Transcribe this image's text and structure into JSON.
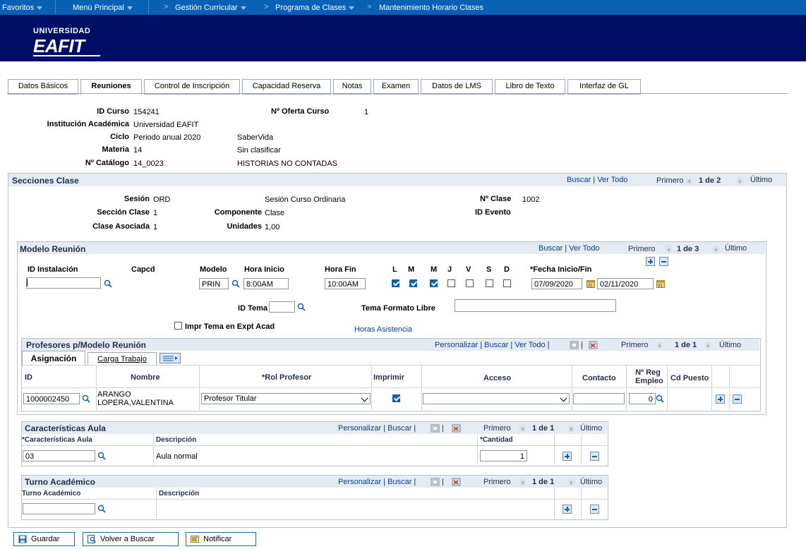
{
  "nav": {
    "favoritos": "Favoritos",
    "menu_principal": "Menú Principal",
    "gestion": "Gestión Curricular",
    "programa": "Programa de Clases",
    "mantenimiento": "Mantenimiento Horario Clases"
  },
  "logo": {
    "top": "UNIVERSIDAD",
    "main": "EAFIT"
  },
  "tabs": [
    {
      "label": "Datos Básicos"
    },
    {
      "label": "Reuniones"
    },
    {
      "label": "Control de Inscripción"
    },
    {
      "label": "Capacidad Reserva"
    },
    {
      "label": "Notas"
    },
    {
      "label": "Examen"
    },
    {
      "label": "Datos de LMS"
    },
    {
      "label": "Libro de Texto"
    },
    {
      "label": "Interfaz de GL"
    }
  ],
  "course": {
    "id_curso_label": "ID Curso",
    "id_curso": "154241",
    "oferta_label": "Nº Oferta Curso",
    "oferta": "1",
    "institucion_label": "Institución Académica",
    "institucion": "Universidad EAFIT",
    "ciclo_label": "Ciclo",
    "ciclo": "Periodo anual 2020",
    "ciclo_desc": "SaberVida",
    "materia_label": "Materia",
    "materia": "14",
    "materia_desc": "Sin clasificar",
    "catalogo_label": "Nº Catálogo",
    "catalogo": "14_0023",
    "catalogo_desc": "HISTORIAS NO CONTADAS"
  },
  "secciones": {
    "title": "Secciones Clase",
    "buscar": "Buscar",
    "ver_todo": "Ver Todo",
    "primero": "Primero",
    "count": "1 de 2",
    "ultimo": "Último",
    "sesion_label": "Sesión",
    "sesion": "ORD",
    "sesion_desc": "Sesión Curso Ordinaria",
    "nclase_label": "Nº Clase",
    "nclase": "1002",
    "seccion_label": "Sección Clase",
    "seccion": "1",
    "componente_label": "Componente",
    "componente": "Clase",
    "evento_label": "ID Evento",
    "asociada_label": "Clase Asociada",
    "asociada": "1",
    "unidades_label": "Unidades",
    "unidades": "1,00"
  },
  "modelo": {
    "title": "Modelo Reunión",
    "buscar": "Buscar",
    "ver_todo": "Ver Todo",
    "primero": "Primero",
    "count": "1 de 3",
    "ultimo": "Último",
    "instalacion_label": "ID Instalación",
    "instalacion": "",
    "capcd_label": "Capcd",
    "modelo_label": "Modelo",
    "modelo": "PRIN",
    "hora_inicio_label": "Hora Inicio",
    "hora_inicio": "8:00AM",
    "hora_fin_label": "Hora Fin",
    "hora_fin": "10:00AM",
    "days": [
      "L",
      "M",
      "M",
      "J",
      "V",
      "S",
      "D"
    ],
    "days_checked": [
      true,
      true,
      true,
      false,
      false,
      false,
      false
    ],
    "fecha_label": "*Fecha Inicio/Fin",
    "fecha_inicio": "07/09/2020",
    "fecha_fin": "02/11/2020",
    "tema_label": "ID Tema",
    "tema": "",
    "tema_libre_label": "Tema Formato Libre",
    "tema_libre": "",
    "impr_tema_label": "Impr Tema en Expt Acad",
    "horas_asistencia": "Horas Asistencia"
  },
  "profesores": {
    "title": "Profesores p/Modelo Reunión",
    "personalizar": "Personalizar",
    "buscar": "Buscar",
    "ver_todo": "Ver Todo",
    "primero": "Primero",
    "count": "1 de 1",
    "ultimo": "Último",
    "subtab_asignacion": "Asignación",
    "subtab_carga": "Carga Trabajo",
    "col_id": "ID",
    "col_nombre": "Nombre",
    "col_rol": "*Rol Profesor",
    "col_imprimir": "Imprimir",
    "col_acceso": "Acceso",
    "col_contacto": "Contacto",
    "col_reg1": "Nº Reg",
    "col_reg2": "Empleo",
    "col_puesto": "Cd Puesto",
    "row": {
      "id": "1000002450",
      "nombre1": "ARANGO",
      "nombre2": "LOPERA,VALENTINA",
      "rol": "Profesor Titular",
      "acceso": "",
      "contacto": "",
      "reg": "0"
    }
  },
  "aula": {
    "title": "Características Aula",
    "personalizar": "Personalizar",
    "buscar": "Buscar",
    "primero": "Primero",
    "count": "1 de 1",
    "ultimo": "Último",
    "col_car": "*Características Aula",
    "col_desc": "Descripción",
    "col_cant": "*Cantidad",
    "row": {
      "car": "03",
      "desc": "Aula normal",
      "cant": "1"
    }
  },
  "turno": {
    "title": "Turno Académico",
    "personalizar": "Personalizar",
    "buscar": "Buscar",
    "primero": "Primero",
    "count": "1 de 1",
    "ultimo": "Último",
    "col_turno": "Turno Académico",
    "col_desc": "Descripción",
    "row": {
      "turno": ""
    }
  },
  "footer": {
    "guardar": "Guardar",
    "volver": "Volver a Buscar",
    "notificar": "Notificar"
  }
}
